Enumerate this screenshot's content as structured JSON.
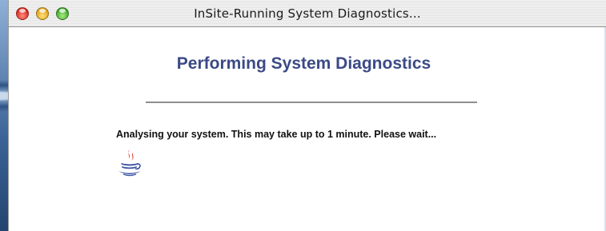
{
  "window": {
    "title": "InSite-Running System Diagnostics..."
  },
  "content": {
    "heading": "Performing System Diagnostics",
    "message": "Analysing your system. This may take up to 1 minute. Please wait..."
  },
  "icons": {
    "close": "close-icon",
    "minimize": "minimize-icon",
    "zoom": "zoom-icon",
    "status": "java-coffee-cup-icon"
  },
  "colors": {
    "heading": "#3b4a86",
    "close_button": "#d8271b",
    "minimize_button": "#e2a11c",
    "zoom_button": "#3ea52a"
  }
}
